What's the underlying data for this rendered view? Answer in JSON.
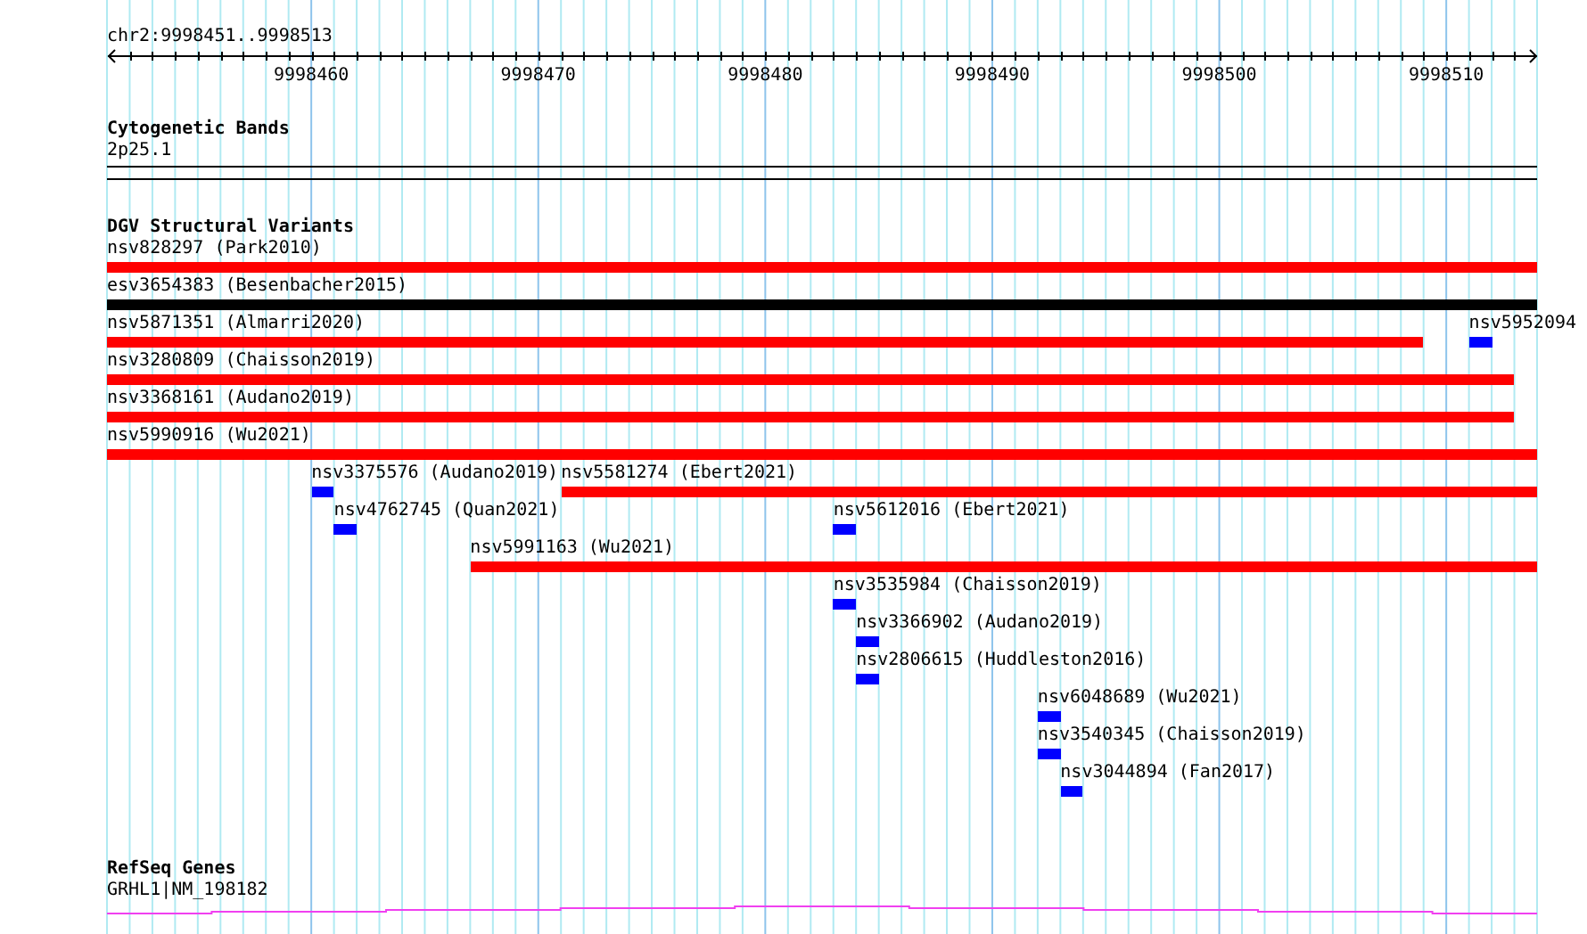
{
  "ruler": {
    "location": "chr2:9998451..9998513",
    "major_ticks": [
      "9998460",
      "9998470",
      "9998480",
      "9998490",
      "9998500",
      "9998510"
    ]
  },
  "tracks": [
    {
      "kind": "bands",
      "title": "Cytogenetic Bands",
      "features": [
        {
          "label": "2p25.1"
        }
      ]
    },
    {
      "kind": "variants",
      "title": "DGV Structural Variants",
      "rows": [
        [
          {
            "label": "nsv828297 (Park2010)",
            "color": "#ff0000"
          }
        ],
        [
          {
            "label": "esv3654383 (Besenbacher2015)",
            "color": "#000000"
          }
        ],
        [
          {
            "label": "nsv5871351 (Almarri2020)",
            "color": "#ff0000"
          },
          {
            "label": "nsv5952094",
            "color": "#0000ff"
          }
        ],
        [
          {
            "label": "nsv3280809 (Chaisson2019)",
            "color": "#ff0000"
          }
        ],
        [
          {
            "label": "nsv3368161 (Audano2019)",
            "color": "#ff0000"
          }
        ],
        [
          {
            "label": "nsv5990916 (Wu2021)",
            "color": "#ff0000"
          }
        ],
        [
          {
            "label": "nsv3375576 (Audano2019)",
            "color": "#0000ff"
          },
          {
            "label": "nsv5581274 (Ebert2021)",
            "color": "#ff0000"
          }
        ],
        [
          {
            "label": "nsv4762745 (Quan2021)",
            "color": "#0000ff"
          },
          {
            "label": "nsv5612016 (Ebert2021)",
            "color": "#0000ff"
          }
        ],
        [
          {
            "label": "nsv5991163 (Wu2021)",
            "color": "#ff0000"
          }
        ],
        [
          {
            "label": "nsv3535984 (Chaisson2019)",
            "color": "#0000ff"
          }
        ],
        [
          {
            "label": "nsv3366902 (Audano2019)",
            "color": "#0000ff"
          }
        ],
        [
          {
            "label": "nsv2806615 (Huddleston2016)",
            "color": "#0000ff"
          }
        ],
        [
          {
            "label": "nsv6048689 (Wu2021)",
            "color": "#0000ff"
          }
        ],
        [
          {
            "label": "nsv3540345 (Chaisson2019)",
            "color": "#0000ff"
          }
        ],
        [
          {
            "label": "nsv3044894 (Fan2017)",
            "color": "#0000ff"
          }
        ]
      ]
    },
    {
      "kind": "genes",
      "title": "RefSeq Genes",
      "features": [
        {
          "label": "GRHL1|NM_198182"
        }
      ]
    }
  ]
}
